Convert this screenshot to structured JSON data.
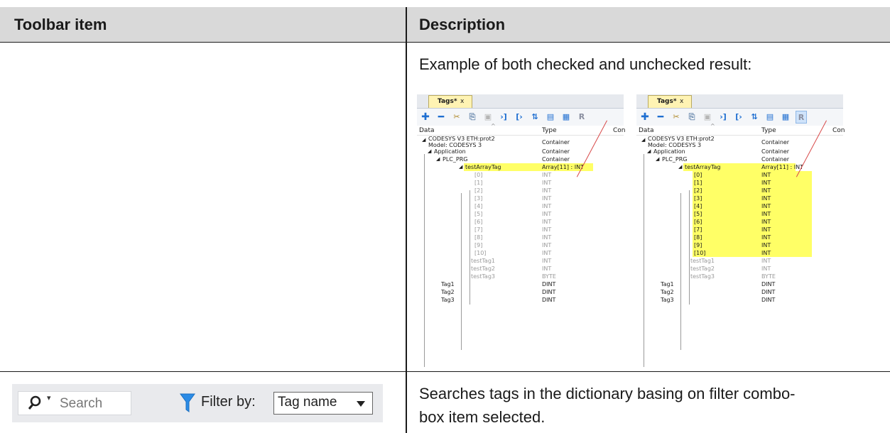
{
  "header": {
    "col1": "Toolbar item",
    "col2": "Description"
  },
  "rows": [
    {
      "description": "Example of both checked and unchecked result:"
    },
    {
      "description_line1": "Searches tags in the dictionary basing on filter combo-",
      "description_line2": "box item selected."
    }
  ],
  "editor": {
    "tab_label": "Tags*",
    "tab_close": "x",
    "columns": [
      "Data",
      "Type",
      "Con"
    ],
    "tree": [
      {
        "name": "CODESYS V3 ETH:prot2",
        "name2": "Model: CODESYS 3",
        "type": "Container"
      },
      {
        "name": "Application",
        "type": "Container"
      },
      {
        "name": "PLC_PRG",
        "type": "Container"
      },
      {
        "name": "testArrayTag",
        "type": "Array[11] : INT"
      },
      {
        "name": "[0]",
        "type": "INT"
      },
      {
        "name": "[1]",
        "type": "INT"
      },
      {
        "name": "[2]",
        "type": "INT"
      },
      {
        "name": "[3]",
        "type": "INT"
      },
      {
        "name": "[4]",
        "type": "INT"
      },
      {
        "name": "[5]",
        "type": "INT"
      },
      {
        "name": "[6]",
        "type": "INT"
      },
      {
        "name": "[7]",
        "type": "INT"
      },
      {
        "name": "[8]",
        "type": "INT"
      },
      {
        "name": "[9]",
        "type": "INT"
      },
      {
        "name": "[10]",
        "type": "INT"
      },
      {
        "name": "testTag1",
        "type": "INT"
      },
      {
        "name": "testTag2",
        "type": "INT"
      },
      {
        "name": "testTag3",
        "type": "BYTE"
      },
      {
        "name": "Tag1",
        "type": "DINT"
      },
      {
        "name": "Tag2",
        "type": "DINT"
      },
      {
        "name": "Tag3",
        "type": "DINT"
      }
    ]
  },
  "searchbar": {
    "search_placeholder": "Search",
    "filter_label": "Filter by:",
    "filter_value": "Tag name"
  },
  "colors": {
    "header_bg": "#d9d9d9",
    "highlight": "#ffff66",
    "arrow": "#d84a4a",
    "plus": "#1f6fd1",
    "filter_icon": "#2b8be6"
  }
}
